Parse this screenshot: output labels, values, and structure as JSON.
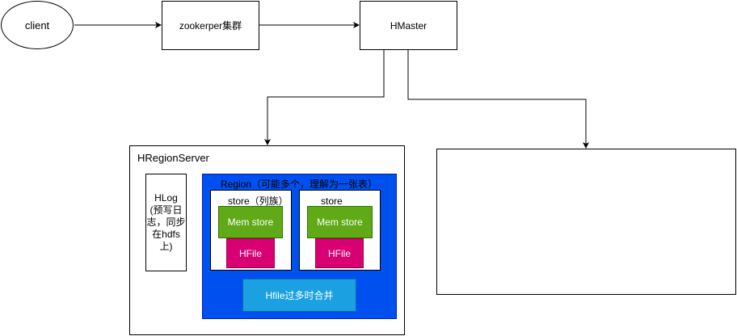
{
  "nodes": {
    "client": "client",
    "zookeeper": "zookerper集群",
    "hmaster": "HMaster",
    "hregionserver": "HRegionServer",
    "hlog": "HLog\n(预写日\n志，同步\n在hdfs\n上)",
    "region": "Region（可能多个，理解为一张表）",
    "store1": "store（列族）",
    "store2": "store",
    "memstore1": "Mem store",
    "memstore2": "Mem store",
    "hfile1": "HFile",
    "hfile2": "HFile",
    "merge": "Hfile过多时合并"
  },
  "colors": {
    "region_fill": "#0050ef",
    "memstore_fill": "#60a917",
    "hfile_fill": "#d80073",
    "merge_fill": "#1ba1e2",
    "stroke": "#000000"
  }
}
